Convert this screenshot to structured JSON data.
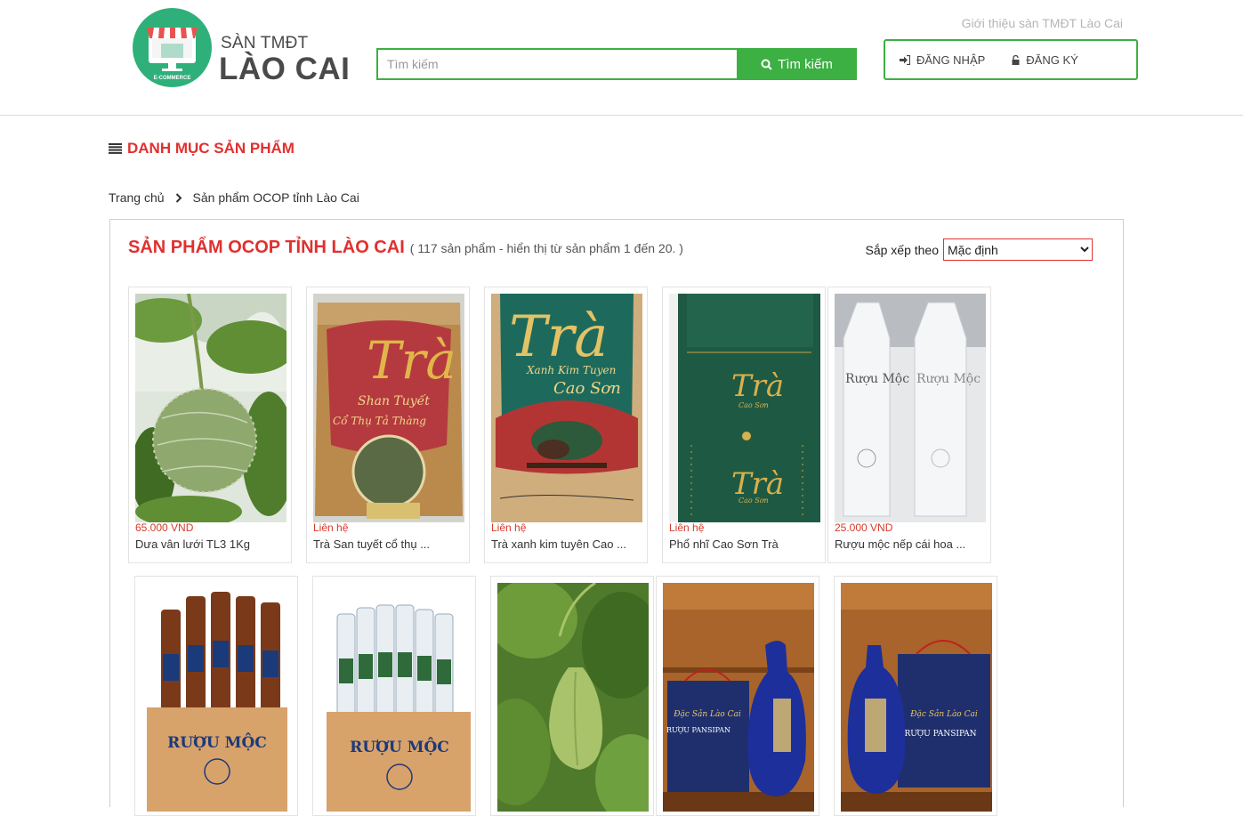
{
  "header": {
    "logo_top": "SÀN TMĐT",
    "logo_main": "LÀO CAI",
    "logo_badge": "E-COMMERCE",
    "intro_link": "Giới thiệu sàn TMĐT Lào Cai",
    "search_placeholder": "Tìm kiếm",
    "search_button": "Tìm kiếm",
    "login": "ĐĂNG NHẬP",
    "register": "ĐĂNG KÝ"
  },
  "category_menu": "DANH MỤC SẢN PHẨM",
  "breadcrumb": [
    "Trang chủ",
    "Sản phẩm OCOP tỉnh Lào Cai"
  ],
  "listing": {
    "title": "SẢN PHẨM OCOP TỈNH LÀO CAI",
    "count_text": "( 117 sản phẩm - hiển thị từ sản phẩm 1 đến 20. )",
    "sort_label": "Sắp xếp theo",
    "sort_value": "Mặc định"
  },
  "products": [
    {
      "price": "65.000 VND",
      "name": "Dưa vân lưới TL3 1Kg"
    },
    {
      "price": "Liên hệ",
      "name": "Trà San tuyết cổ thụ ..."
    },
    {
      "price": "Liên hệ",
      "name": "Trà xanh kim tuyên Cao ..."
    },
    {
      "price": "Liên hệ",
      "name": "Phổ nhĩ Cao Sơn Trà"
    },
    {
      "price": "25.000 VND",
      "name": "Rượu mộc nếp cái hoa ..."
    },
    {
      "price": "",
      "name": ""
    },
    {
      "price": "",
      "name": ""
    },
    {
      "price": "",
      "name": ""
    },
    {
      "price": "",
      "name": ""
    },
    {
      "price": "",
      "name": ""
    }
  ],
  "image_text": {
    "tra": "Trà",
    "tra_sub1": "Shan Tuyết",
    "tra_sub2": "Cổ Thụ Tả Thàng",
    "tra2_sub1": "Xanh Kim Tuyen",
    "tra2_sub2": "Cao Sơn",
    "pho_tra": "Trà",
    "pho_sub": "Cao Sơn",
    "ruou_moc": "Rượu Mộc",
    "ruou_moc_box": "RƯỢU MỘC",
    "pansipan": "RƯỢU PANSIPAN",
    "dac_san": "Đặc Sản Lào Cai"
  }
}
